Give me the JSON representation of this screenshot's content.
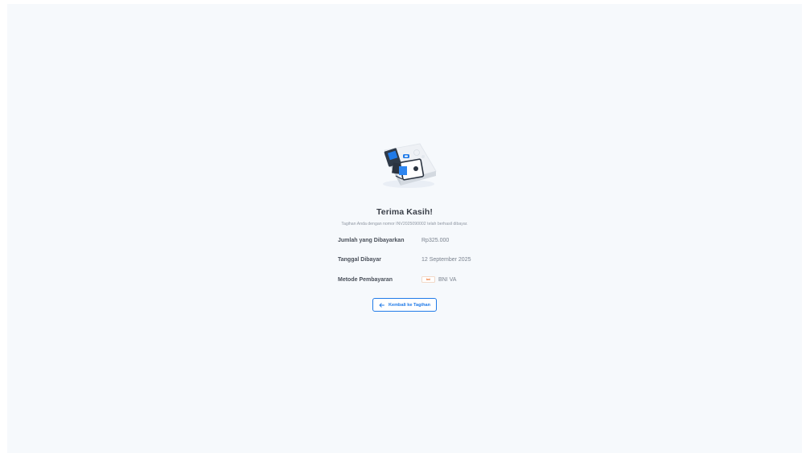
{
  "success": {
    "title": "Terima Kasih!",
    "message": "Tagihan Anda dengan nomor INV2025090002 telah berhasil dibayar."
  },
  "details": [
    {
      "label": "Jumlah yang Dibayarkan",
      "value": "Rp325.000"
    },
    {
      "label": "Tanggal Dibayar",
      "value": "12 September 2025"
    },
    {
      "label": "Metode Pembayaran",
      "value": "BNI VA",
      "logo_text": "bni",
      "logo_color": "#f26b21"
    }
  ],
  "back_button": {
    "label": "Kembali ke Tagihan",
    "icon": "arrow-left-icon"
  },
  "colors": {
    "accent": "#1f7ae8",
    "background": "#f6f9fc"
  }
}
